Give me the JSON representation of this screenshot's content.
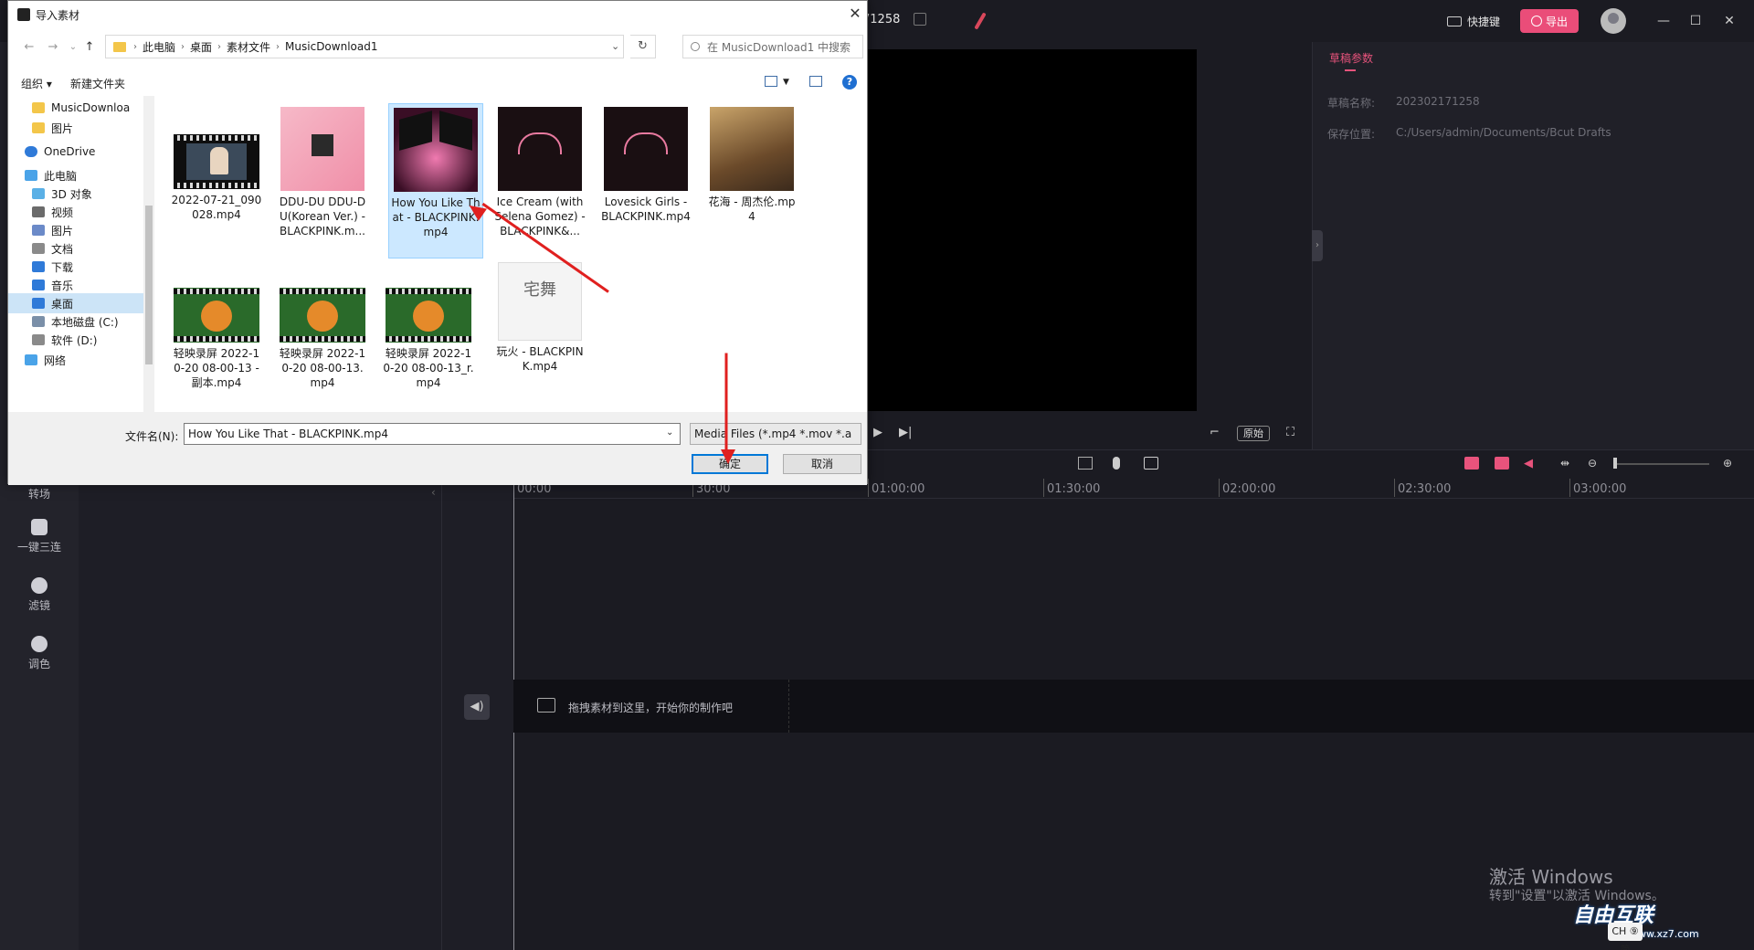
{
  "editor": {
    "draft_title": "71258",
    "shortcut_label": "快捷键",
    "export_label": "导出",
    "window_buttons": [
      "—",
      "☐",
      "✕"
    ],
    "rail": [
      {
        "label": "转场"
      },
      {
        "label": "一键三连"
      },
      {
        "label": "滤镜"
      },
      {
        "label": "调色"
      }
    ],
    "right_panel": {
      "tab": "草稿参数",
      "rows": [
        {
          "label": "草稿名称:",
          "value": "202302171258"
        },
        {
          "label": "保存位置:",
          "value": "C:/Users/admin/Documents/Bcut Drafts"
        }
      ]
    },
    "player": {
      "original_label": "原始"
    },
    "timeline": {
      "ticks": [
        "00:00",
        "30:00",
        "01:00:00",
        "01:30:00",
        "02:00:00",
        "02:30:00",
        "03:00:00"
      ],
      "drop_hint": "拖拽素材到这里，开始你的制作吧"
    },
    "watermark": {
      "title": "激活 Windows",
      "subtitle": "转到\"设置\"以激活 Windows。",
      "brand": "自由互联",
      "brand_url": "www.xz7.com",
      "ime": "CH ⑨ 简"
    }
  },
  "dialog": {
    "title": "导入素材",
    "close": "✕",
    "nav_buttons": [
      "←",
      "→",
      "⌄",
      "↑"
    ],
    "breadcrumb": [
      "此电脑",
      "桌面",
      "素材文件",
      "MusicDownload1"
    ],
    "search_placeholder": "在 MusicDownload1 中搜索",
    "toolbar": {
      "organize": "组织 ▾",
      "new_folder": "新建文件夹",
      "help": "?"
    },
    "nav_items": [
      {
        "label": "MusicDownloa",
        "icon": "folder-icon",
        "color": "#f3c64a"
      },
      {
        "label": "图片",
        "icon": "folder-icon",
        "color": "#f3c64a"
      },
      {
        "label": "OneDrive",
        "icon": "cloud-icon",
        "color": "#2f7ad8"
      },
      {
        "label": "此电脑",
        "icon": "computer-icon",
        "color": "#4aa3e8"
      },
      {
        "label": "3D 对象",
        "icon": "cube-icon",
        "color": "#5ab0e6"
      },
      {
        "label": "视频",
        "icon": "video-icon",
        "color": "#6b6b6b"
      },
      {
        "label": "图片",
        "icon": "picture-icon",
        "color": "#6b8ac8"
      },
      {
        "label": "文档",
        "icon": "document-icon",
        "color": "#8a8a8a"
      },
      {
        "label": "下载",
        "icon": "download-icon",
        "color": "#2f7ad8"
      },
      {
        "label": "音乐",
        "icon": "music-icon",
        "color": "#2f7ad8"
      },
      {
        "label": "桌面",
        "icon": "desktop-icon",
        "color": "#2f7ad8"
      },
      {
        "label": "本地磁盘 (C:)",
        "icon": "drive-icon",
        "color": "#7a8fa8"
      },
      {
        "label": "软件 (D:)",
        "icon": "drive-icon",
        "color": "#8a8a8a"
      },
      {
        "label": "网络",
        "icon": "network-icon",
        "color": "#4aa3e8"
      }
    ],
    "files": [
      {
        "name": "2022-07-21_090028.mp4",
        "kind": "film"
      },
      {
        "name": "DDU-DU DDU-DU(Korean Ver.) - BLACKPINK.m...",
        "kind": "pink"
      },
      {
        "name": "How You Like That - BLACKPINK.mp4",
        "kind": "wings",
        "selected": true
      },
      {
        "name": "Ice Cream (with Selena Gomez) - BLACKPINK&...",
        "kind": "crown"
      },
      {
        "name": "Lovesick Girls - BLACKPINK.mp4",
        "kind": "crown"
      },
      {
        "name": "花海 - 周杰伦.mp4",
        "kind": "anime"
      },
      {
        "name": "轻映录屏 2022-10-20 08-00-13 - 副本.mp4",
        "kind": "tiger"
      },
      {
        "name": "轻映录屏 2022-10-20 08-00-13.mp4",
        "kind": "tiger"
      },
      {
        "name": "轻映录屏 2022-10-20 08-00-13_r.mp4",
        "kind": "tiger"
      },
      {
        "name": "玩火 - BLACKPINK.mp4",
        "kind": "text",
        "thumb_text": "宅舞"
      }
    ],
    "filename_label": "文件名(N):",
    "filename_value": "How You Like That - BLACKPINK.mp4",
    "filter_value": "Media Files (*.mp4 *.mov *.a",
    "ok_label": "确定",
    "cancel_label": "取消"
  }
}
